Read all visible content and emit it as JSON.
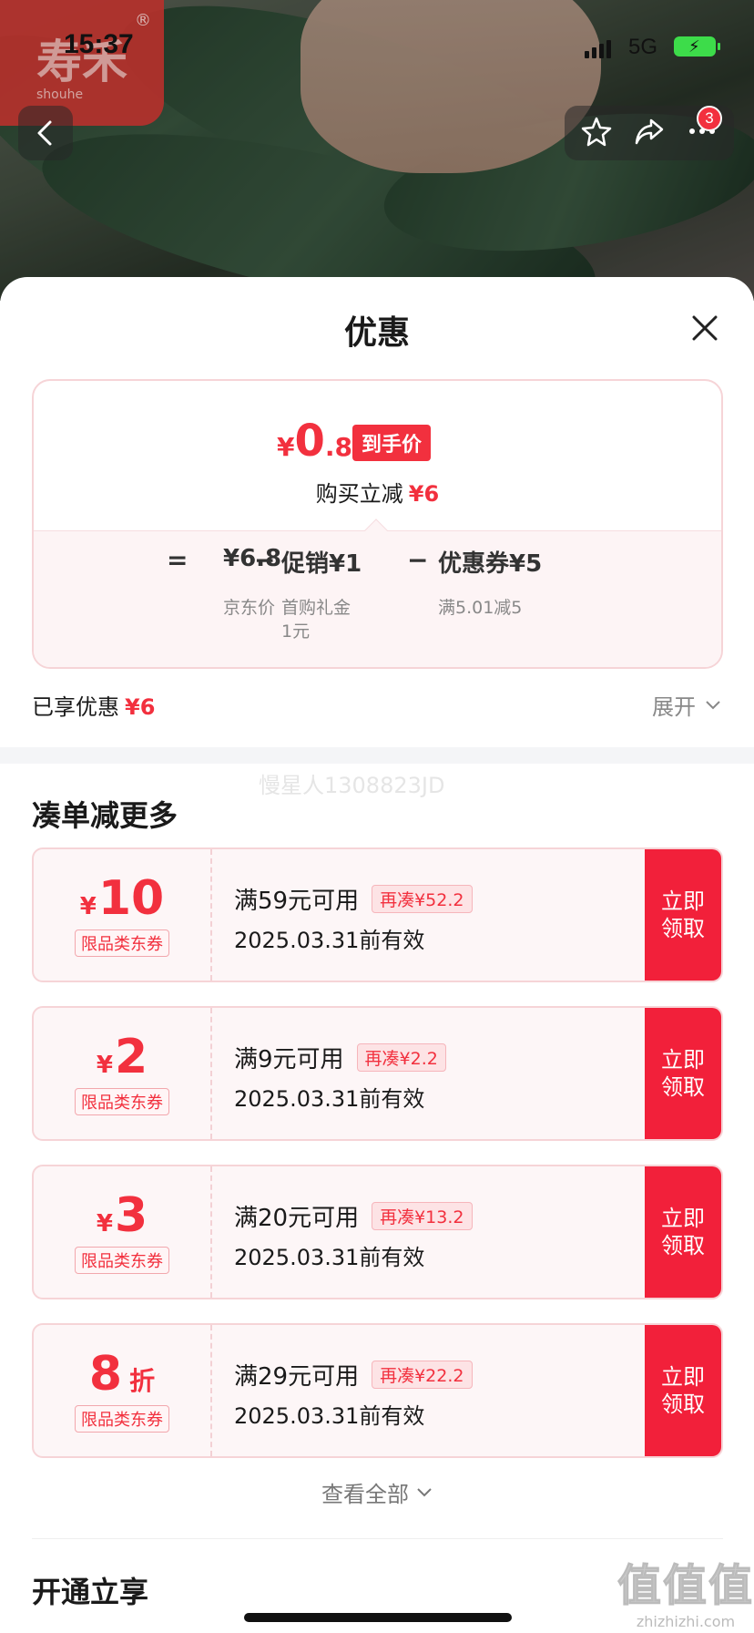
{
  "status_bar": {
    "time": "15:37",
    "network": "5G"
  },
  "logo": {
    "mark": "寿禾",
    "subtitle": "shouhe",
    "registered": "®"
  },
  "top_bar": {
    "cart_badge": "3"
  },
  "sheet": {
    "title": "优惠"
  },
  "price_card": {
    "final_price_yen": "¥",
    "final_price_int": "0",
    "final_price_dec": ".8",
    "final_price_tag": "到手价",
    "buy_reduce_label": "购买立减",
    "buy_reduce_amount": "¥6",
    "calc": {
      "equals": "=",
      "jd_price": "¥6.8",
      "jd_price_label": "京东价",
      "minus1": "−",
      "promo": "促销¥1",
      "promo_label": "首购礼金",
      "promo_label2": "1元",
      "minus2": "−",
      "coupon": "优惠券¥5",
      "coupon_label": "满5.01减5"
    }
  },
  "enjoyed": {
    "label": "已享优惠",
    "amount": "¥6",
    "expand": "展开"
  },
  "watermark": "慢星人1308823JD",
  "more_section": {
    "title": "凑单减更多"
  },
  "coupons": [
    {
      "yen": "¥",
      "num": "10",
      "unit": "",
      "type": "限品类东券",
      "cond": "满59元可用",
      "tag": "再凑¥52.2",
      "date": "2025.03.31前有效",
      "btn": "立即领取"
    },
    {
      "yen": "¥",
      "num": "2",
      "unit": "",
      "type": "限品类东券",
      "cond": "满9元可用",
      "tag": "再凑¥2.2",
      "date": "2025.03.31前有效",
      "btn": "立即领取"
    },
    {
      "yen": "¥",
      "num": "3",
      "unit": "",
      "type": "限品类东券",
      "cond": "满20元可用",
      "tag": "再凑¥13.2",
      "date": "2025.03.31前有效",
      "btn": "立即领取"
    },
    {
      "yen": "",
      "num": "8",
      "unit": "折",
      "type": "限品类东券",
      "cond": "满29元可用",
      "tag": "再凑¥22.2",
      "date": "2025.03.31前有效",
      "btn": "立即领取"
    }
  ],
  "view_all": "查看全部",
  "open_section": {
    "title": "开通立享"
  },
  "brand_watermark": {
    "big": "值值值",
    "small": "zhizhizhi.com"
  },
  "colors": {
    "accent_red": "#f2303e",
    "button_red": "#f2203a"
  }
}
